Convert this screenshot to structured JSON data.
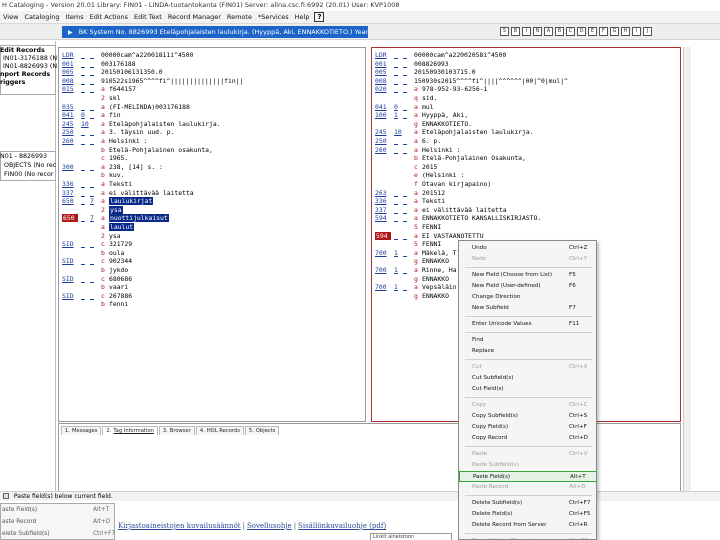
{
  "window": {
    "title": "H Cataloging - Version 20.01  Library: FIN01 - LINDA-tuotantokanta (FIN01)  Server: alina.csc.fi:6992 (20.01)  User: KVP1008"
  },
  "menubar": {
    "items": [
      "View",
      "Cataloging",
      "Items",
      "Edit Actions",
      "Edit Text",
      "Record Manager",
      "Remote",
      "*Services",
      "Help"
    ],
    "help_label": "?"
  },
  "toolbar": {
    "record_title": "BK System No. 8826993 Eteläpohjalaisten laulukirja. (Hyyppä, Aki, ENNAKKOTIETO.) Year: 2015",
    "icon_labels": [
      "S",
      "B",
      "I",
      "N",
      "A",
      "B",
      "C",
      "D",
      "E",
      "F",
      "G",
      "H",
      "I",
      "J"
    ]
  },
  "left_tree": {
    "items": [
      "Edit Records",
      "IN01-3176188 (N",
      "IN01-8826993 (N",
      "nport Records",
      "riggers"
    ],
    "lower_items": [
      "N01 - 8826993",
      "OBJECTS (No rec",
      "FIN00 (No recor"
    ]
  },
  "left_record": {
    "fields": [
      {
        "tag": "LDR",
        "ind1": "_",
        "ind2": "_",
        "sub": "",
        "val": "00000cam^a22001811i^4500"
      },
      {
        "tag": "001",
        "ind1": "_",
        "ind2": "_",
        "sub": "",
        "val": "003176188"
      },
      {
        "tag": "005",
        "ind1": "_",
        "ind2": "_",
        "sub": "",
        "val": "20150106131350.0"
      },
      {
        "tag": "008",
        "ind1": "_",
        "ind2": "_",
        "sub": "",
        "val": "910522s1965^^^^fi^||||||||||||||fin||"
      },
      {
        "tag": "015",
        "ind1": "_",
        "ind2": "_",
        "sub": "a",
        "val": "f644157"
      },
      {
        "tag": "",
        "ind1": "",
        "ind2": "",
        "sub": "2",
        "val": "skl"
      },
      {
        "tag": "035",
        "ind1": "_",
        "ind2": "_",
        "sub": "a",
        "val": "(FI-MELINDA)003176188"
      },
      {
        "tag": "041",
        "ind1": "0",
        "ind2": "_",
        "sub": "a",
        "val": "fin"
      },
      {
        "tag": "245",
        "ind1": "10",
        "ind2": "",
        "sub": "a",
        "val": "Eteläpohjalaisten laulukirja."
      },
      {
        "tag": "250",
        "ind1": "_",
        "ind2": "_",
        "sub": "a",
        "val": "3. täysin uud. p."
      },
      {
        "tag": "260",
        "ind1": "_",
        "ind2": "_",
        "sub": "a",
        "val": "Helsinki :"
      },
      {
        "tag": "",
        "ind1": "",
        "ind2": "",
        "sub": "b",
        "val": "Etelä-Pohjalainen osakunta,"
      },
      {
        "tag": "",
        "ind1": "",
        "ind2": "",
        "sub": "c",
        "val": "1965."
      },
      {
        "tag": "300",
        "ind1": "_",
        "ind2": "_",
        "sub": "a",
        "val": "238, [14] s. :"
      },
      {
        "tag": "",
        "ind1": "",
        "ind2": "",
        "sub": "b",
        "val": "kuv."
      },
      {
        "tag": "336",
        "ind1": "_",
        "ind2": "_",
        "sub": "a",
        "val": "Teksti"
      },
      {
        "tag": "337",
        "ind1": "_",
        "ind2": "_",
        "sub": "a",
        "val": "ei välittävää laitetta"
      },
      {
        "tag": "650",
        "ind1": "_",
        "ind2": "7",
        "sub": "a",
        "val": "laulukirjat"
      },
      {
        "tag": "",
        "ind1": "",
        "ind2": "",
        "sub": "2",
        "val": "ysa"
      },
      {
        "tag": "650",
        "ind1": "_",
        "ind2": "7",
        "sub": "a",
        "val": "nuottijulkaisut"
      },
      {
        "tag": "",
        "ind1": "",
        "ind2": "",
        "sub": "a",
        "val": "laulut"
      },
      {
        "tag": "",
        "ind1": "",
        "ind2": "",
        "sub": "2",
        "val": "ysa"
      },
      {
        "tag": "SID",
        "ind1": "_",
        "ind2": "_",
        "sub": "c",
        "val": "321729"
      },
      {
        "tag": "",
        "ind1": "",
        "ind2": "",
        "sub": "b",
        "val": "oula"
      },
      {
        "tag": "SID",
        "ind1": "_",
        "ind2": "_",
        "sub": "c",
        "val": "902344"
      },
      {
        "tag": "",
        "ind1": "",
        "ind2": "",
        "sub": "b",
        "val": "jykdo"
      },
      {
        "tag": "SID",
        "ind1": "_",
        "ind2": "_",
        "sub": "c",
        "val": "680686"
      },
      {
        "tag": "",
        "ind1": "",
        "ind2": "",
        "sub": "b",
        "val": "vaari"
      },
      {
        "tag": "SID",
        "ind1": "_",
        "ind2": "_",
        "sub": "c",
        "val": "267886"
      },
      {
        "tag": "",
        "ind1": "",
        "ind2": "",
        "sub": "b",
        "val": "fenni"
      }
    ]
  },
  "right_record": {
    "fields": [
      {
        "tag": "LDR",
        "ind1": "_",
        "ind2": "_",
        "sub": "",
        "val": "00000cam^a22002058i^4500"
      },
      {
        "tag": "001",
        "ind1": "_",
        "ind2": "_",
        "sub": "",
        "val": "008826993"
      },
      {
        "tag": "005",
        "ind1": "_",
        "ind2": "_",
        "sub": "",
        "val": "20150930103715.0"
      },
      {
        "tag": "008",
        "ind1": "_",
        "ind2": "_",
        "sub": "",
        "val": "150930s2015^^^^fi^||||^^^^^^|00|^0|mul|^"
      },
      {
        "tag": "020",
        "ind1": "_",
        "ind2": "_",
        "sub": "a",
        "val": "978-952-93-6256-1"
      },
      {
        "tag": "",
        "ind1": "",
        "ind2": "",
        "sub": "q",
        "val": "sid."
      },
      {
        "tag": "041",
        "ind1": "0",
        "ind2": "_",
        "sub": "a",
        "val": "mul"
      },
      {
        "tag": "100",
        "ind1": "1",
        "ind2": "_",
        "sub": "a",
        "val": "Hyyppä, Aki,"
      },
      {
        "tag": "",
        "ind1": "",
        "ind2": "",
        "sub": "g",
        "val": "ENNAKKOTIETO."
      },
      {
        "tag": "245",
        "ind1": "10",
        "ind2": "",
        "sub": "a",
        "val": "Eteläpohjalaisten laulukirja."
      },
      {
        "tag": "250",
        "ind1": "_",
        "ind2": "_",
        "sub": "a",
        "val": "6. p."
      },
      {
        "tag": "260",
        "ind1": "_",
        "ind2": "_",
        "sub": "a",
        "val": "Helsinki :"
      },
      {
        "tag": "",
        "ind1": "",
        "ind2": "",
        "sub": "b",
        "val": "Etelä-Pohjalainen Osakunta,"
      },
      {
        "tag": "",
        "ind1": "",
        "ind2": "",
        "sub": "c",
        "val": "2015"
      },
      {
        "tag": "",
        "ind1": "",
        "ind2": "",
        "sub": "e",
        "val": "(Helsinki :"
      },
      {
        "tag": "",
        "ind1": "",
        "ind2": "",
        "sub": "f",
        "val": "Otavan kirjapaino)"
      },
      {
        "tag": "263",
        "ind1": "_",
        "ind2": "_",
        "sub": "a",
        "val": "201512"
      },
      {
        "tag": "336",
        "ind1": "_",
        "ind2": "_",
        "sub": "a",
        "val": "Teksti"
      },
      {
        "tag": "337",
        "ind1": "_",
        "ind2": "_",
        "sub": "a",
        "val": "ei välittävää laitetta"
      },
      {
        "tag": "594",
        "ind1": "_",
        "ind2": "_",
        "sub": "a",
        "val": "ENNAKKOTIETO KANSALLISKIRJASTO."
      },
      {
        "tag": "",
        "ind1": "",
        "ind2": "",
        "sub": "5",
        "val": "FENNI"
      },
      {
        "tag": "594",
        "ind1": "_",
        "ind2": "_",
        "sub": "a",
        "val": "EI VASTAANOTETTU"
      },
      {
        "tag": "",
        "ind1": "",
        "ind2": "",
        "sub": "5",
        "val": "FENNI"
      },
      {
        "tag": "700",
        "ind1": "1",
        "ind2": "_",
        "sub": "a",
        "val": "Mäkelä, T"
      },
      {
        "tag": "",
        "ind1": "",
        "ind2": "",
        "sub": "g",
        "val": "ENNAKKO"
      },
      {
        "tag": "700",
        "ind1": "1",
        "ind2": "_",
        "sub": "a",
        "val": "Rinne, Ha"
      },
      {
        "tag": "",
        "ind1": "",
        "ind2": "",
        "sub": "g",
        "val": "ENNAKKO"
      },
      {
        "tag": "700",
        "ind1": "1",
        "ind2": "_",
        "sub": "a",
        "val": "Vepsäläin"
      },
      {
        "tag": "",
        "ind1": "",
        "ind2": "",
        "sub": "g",
        "val": "ENNAKKO"
      }
    ]
  },
  "bottom_tabs": {
    "items": [
      {
        "num": "1.",
        "label": "Messages"
      },
      {
        "num": "2.",
        "label": "Tag Information"
      },
      {
        "num": "3.",
        "label": "Browser"
      },
      {
        "num": "4.",
        "label": "HOL Records"
      },
      {
        "num": "5.",
        "label": "Objects"
      }
    ]
  },
  "statusbar": {
    "text": "Paste field(s) below current field."
  },
  "context_menu": {
    "items": [
      {
        "label": "Undo",
        "shortcut": "Ctrl+Z",
        "disabled": false
      },
      {
        "label": "Redo",
        "shortcut": "Ctrl+Y",
        "disabled": true
      },
      {
        "sep": true
      },
      {
        "label": "New Field (Choose from List)",
        "shortcut": "F5",
        "disabled": false
      },
      {
        "label": "New Field (User-defined)",
        "shortcut": "F6",
        "disabled": false
      },
      {
        "label": "Change Direction",
        "shortcut": "",
        "disabled": false
      },
      {
        "label": "New Subfield",
        "shortcut": "F7",
        "disabled": false
      },
      {
        "sep": true
      },
      {
        "label": "Enter Unicode Values",
        "shortcut": "F11",
        "disabled": false
      },
      {
        "sep": true
      },
      {
        "label": "Find",
        "shortcut": "",
        "disabled": false
      },
      {
        "label": "Replace",
        "shortcut": "",
        "disabled": false
      },
      {
        "sep": true
      },
      {
        "label": "Cut",
        "shortcut": "Ctrl+X",
        "disabled": true
      },
      {
        "label": "Cut Subfield(s)",
        "shortcut": "",
        "disabled": false
      },
      {
        "label": "Cut Field(s)",
        "shortcut": "",
        "disabled": false
      },
      {
        "sep": true
      },
      {
        "label": "Copy",
        "shortcut": "Ctrl+C",
        "disabled": true
      },
      {
        "label": "Copy Subfield(s)",
        "shortcut": "Ctrl+S",
        "disabled": false
      },
      {
        "label": "Copy Field(s)",
        "shortcut": "Ctrl+F",
        "disabled": false
      },
      {
        "label": "Copy Record",
        "shortcut": "Ctrl+D",
        "disabled": false
      },
      {
        "sep": true
      },
      {
        "label": "Paste",
        "shortcut": "Ctrl+V",
        "disabled": true
      },
      {
        "label": "Paste Subfield(s)",
        "shortcut": "",
        "disabled": true
      },
      {
        "label": "Paste Field(s)",
        "shortcut": "Alt+T",
        "disabled": false,
        "selected": true
      },
      {
        "label": "Paste Record",
        "shortcut": "Alt+D",
        "disabled": true
      },
      {
        "sep": true
      },
      {
        "label": "Delete Subfield(s)",
        "shortcut": "Ctrl+F7",
        "disabled": false
      },
      {
        "label": "Delete Field(s)",
        "shortcut": "Ctrl+F5",
        "disabled": false
      },
      {
        "label": "Delete Record from Server",
        "shortcut": "Ctrl+R",
        "disabled": false
      },
      {
        "sep": true
      },
      {
        "label": "Show Hidden Characters",
        "shortcut": "Alt+F2",
        "disabled": true
      }
    ]
  },
  "bottom_left_menu": {
    "items": [
      {
        "label": "aste Field(s)",
        "shortcut": "Alt+T"
      },
      {
        "label": "aste Record",
        "shortcut": "Alt+D"
      },
      {
        "label": "elete Subfield(s)",
        "shortcut": "Ctrl+F7"
      }
    ]
  },
  "web_links": {
    "items": [
      "Kirjastoaineistojen kuvailusäännöt",
      "Sovellusohje",
      "Sisällönkuvailuohje (pdf)"
    ],
    "separator": "|",
    "box_text": "Linkit aineistoon"
  }
}
